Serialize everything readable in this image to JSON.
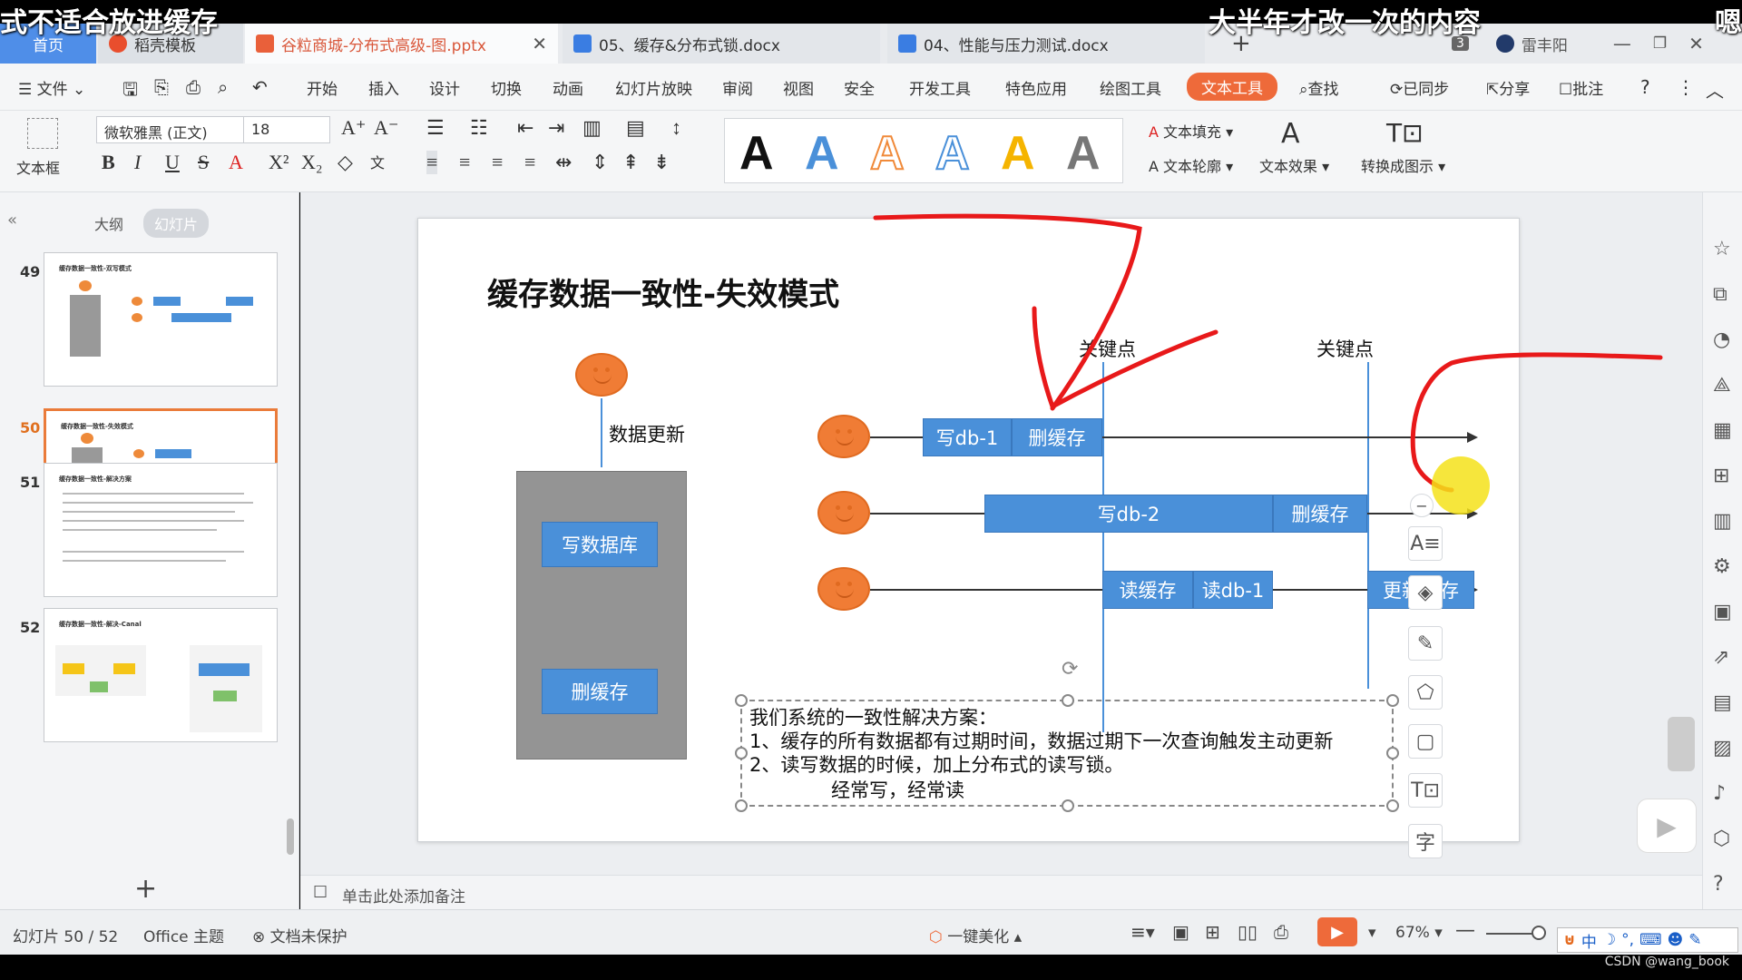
{
  "overlay": {
    "left_text": "式不适合放进缓存",
    "right_text": "大半年才改一次的内容",
    "far_right": "嗯"
  },
  "tabs": {
    "home": "首页",
    "daoke": "稻壳模板",
    "pptx": "谷粒商城-分布式高级-图.pptx",
    "doc1": "05、缓存&分布式锁.docx",
    "doc2": "04、性能与压力测试.docx"
  },
  "window": {
    "badge": "3",
    "user": "雷丰阳"
  },
  "menu": {
    "file": "文件",
    "start": "开始",
    "insert": "插入",
    "design": "设计",
    "switch": "切换",
    "anim": "动画",
    "show": "幻灯片放映",
    "review": "审阅",
    "view": "视图",
    "safe": "安全",
    "dev": "开发工具",
    "special": "特色应用",
    "draw": "绘图工具",
    "texttool": "文本工具",
    "find": "查找",
    "synced": "已同步",
    "share": "分享",
    "comment": "批注"
  },
  "ribbon": {
    "textbox": "文本框",
    "font": "微软雅黑 (正文)",
    "size": "18",
    "fill": "文本填充",
    "outline": "文本轮廓",
    "effect": "文本效果",
    "convert": "转换成图示"
  },
  "left": {
    "outline": "大纲",
    "slides": "幻灯片",
    "nums": [
      "49",
      "50",
      "51",
      "52"
    ],
    "titles": [
      "缓存数据一致性-双写模式",
      "缓存数据一致性-失效模式",
      "缓存数据一致性-解决方案",
      "缓存数据一致性-解决-Canal"
    ]
  },
  "slide": {
    "title": "缓存数据一致性-失效模式",
    "data_update": "数据更新",
    "write_db": "写数据库",
    "del_cache": "删缓存",
    "key1": "关键点",
    "key2": "关键点",
    "row1": {
      "a": "写db-1",
      "b": "删缓存"
    },
    "row2": {
      "a": "写db-2",
      "b": "删缓存"
    },
    "row3": {
      "a": "读缓存",
      "b": "读db-1",
      "c": "更新缓存"
    },
    "text": [
      "我们系统的一致性解决方案：",
      "1、缓存的所有数据都有过期时间，数据过期下一次查询触发主动更新",
      "2、读写数据的时候，加上分布式的读写锁。",
      "经常写，经常读"
    ]
  },
  "notes": "单击此处添加备注",
  "status": {
    "slide": "幻灯片 50 / 52",
    "theme": "Office 主题",
    "protect": "文档未保护",
    "beautify": "一键美化",
    "zoom": "67%"
  },
  "ime": "中",
  "credit": "CSDN @wang_book"
}
